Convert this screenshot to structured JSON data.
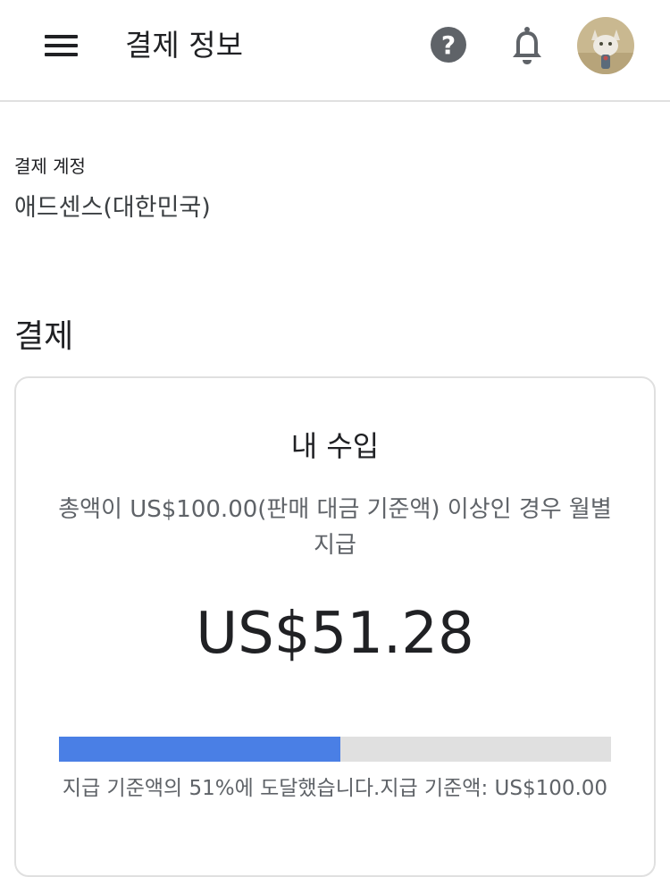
{
  "header": {
    "title": "결제 정보",
    "menu_icon": "hamburger-menu-icon",
    "help_icon": "help-circle-icon",
    "notification_icon": "bell-icon",
    "avatar_icon": "cat-avatar-photo"
  },
  "account": {
    "label": "결제 계정",
    "value": "애드센스(대한민국)"
  },
  "payments": {
    "section_title": "결제",
    "card": {
      "title": "내 수입",
      "description": "총액이 US$100.00(판매 대금 기준액) 이상인 경우 월별 지급",
      "amount": "US$51.28",
      "progress_percent": 51,
      "progress_caption": "지급 기준액의 51%에 도달했습니다.지급 기준액: US$100.00"
    }
  },
  "colors": {
    "accent": "#4a7fe5",
    "track": "#e0e0e0",
    "text_primary": "#202124",
    "text_secondary": "#5f6368"
  }
}
